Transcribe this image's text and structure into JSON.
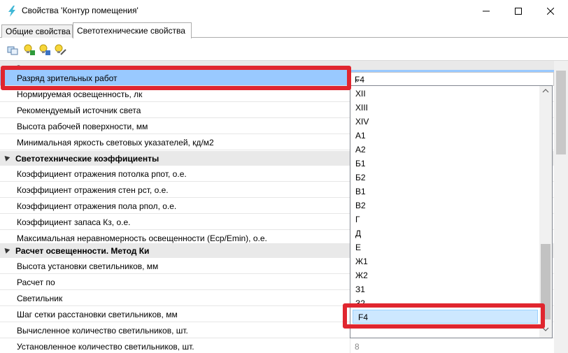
{
  "window": {
    "title": "Свойства 'Контур помещения'",
    "min_glyph": "—",
    "max_glyph": "☐",
    "close_glyph": "✕"
  },
  "tabs": [
    {
      "label": "Общие свойства",
      "active": false
    },
    {
      "label": "Светотехнические свойства",
      "active": true
    }
  ],
  "toolbar": {
    "icons": [
      "copy-properties-icon",
      "bulb-k-icon",
      "bulb-table-icon",
      "bulb-brush-icon"
    ]
  },
  "categories": [
    {
      "title": "Светотехнические характеристики",
      "rows": [
        {
          "label": "Разряд зрительных работ",
          "value": "F4",
          "selected": true
        },
        {
          "label": "Нормируемая освещенность, лк",
          "value": ""
        },
        {
          "label": "Рекомендуемый источник света",
          "value": ""
        },
        {
          "label": "Высота рабочей поверхности, мм",
          "value": ""
        },
        {
          "label": "Минимальная яркость световых указателей, кд/м2",
          "value": ""
        }
      ]
    },
    {
      "title": "Светотехнические коэффициенты",
      "rows": [
        {
          "label": "Коэффициент отражения потолка рпот, о.е.",
          "value": ""
        },
        {
          "label": "Коэффициент отражения стен рст, о.е.",
          "value": ""
        },
        {
          "label": "Коэффициент отражения пола рпол, о.е.",
          "value": ""
        },
        {
          "label": "Коэффициент запаса Кз, о.е.",
          "value": ""
        },
        {
          "label": "Максимальная неравномерность освещенности (Еср/Emin), о.е.",
          "value": ""
        }
      ]
    },
    {
      "title": "Расчет освещенности. Метод Ки",
      "rows": [
        {
          "label": "Высота установки светильников, мм",
          "value": ""
        },
        {
          "label": "Расчет по",
          "value": ""
        },
        {
          "label": "Светильник",
          "value": ""
        },
        {
          "label": "Шаг сетки расстановки светильников, мм",
          "value": ""
        },
        {
          "label": "Вычисленное количество светильников, шт.",
          "value": ""
        },
        {
          "label": "Установленное количество светильников, шт.",
          "value": "8"
        }
      ]
    }
  ],
  "combo": {
    "value": "F4",
    "chevron": "⌄"
  },
  "dropdown": {
    "options": [
      "XII",
      "XIII",
      "XIV",
      "А1",
      "А2",
      "Б1",
      "Б2",
      "В1",
      "В2",
      "Г",
      "Д",
      "Е",
      "Ж1",
      "Ж2",
      "З1",
      "З2",
      "F4"
    ],
    "selected": "F4"
  },
  "colors": {
    "highlight": "#e0262f",
    "selection": "#99c9ff",
    "dropdown_selection": "#cde8ff"
  }
}
